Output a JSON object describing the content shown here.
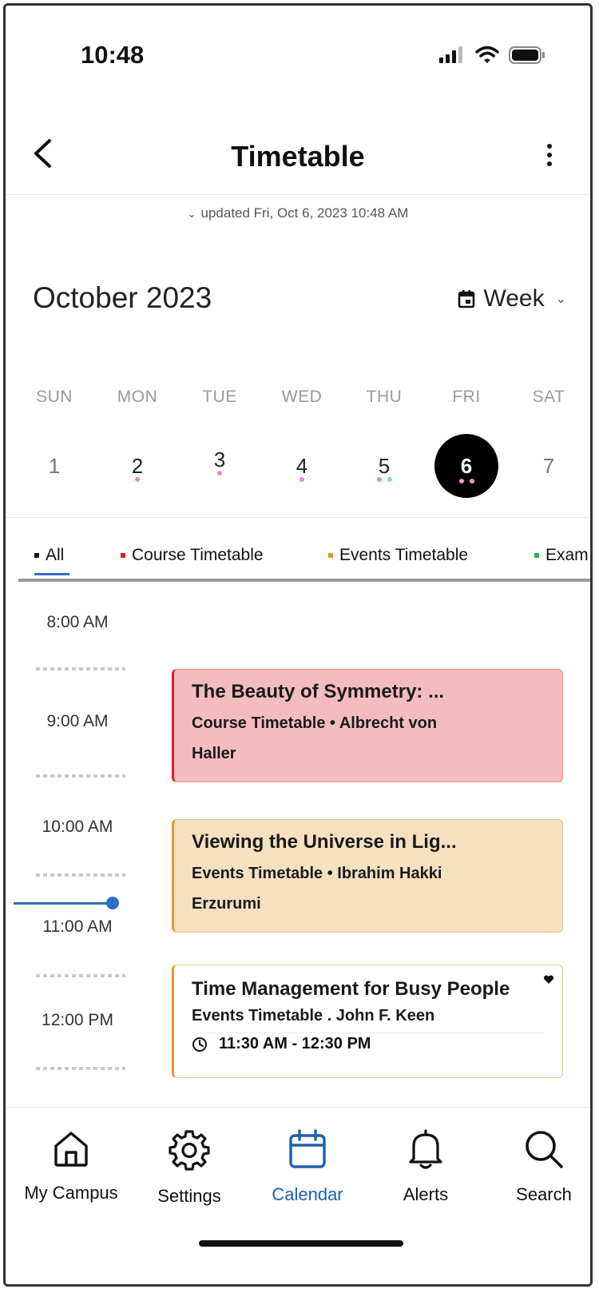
{
  "status_bar": {
    "time": "10:48"
  },
  "header": {
    "title": "Timetable",
    "updated": "updated Fri, Oct 6, 2023 10:48 AM"
  },
  "calendar": {
    "month": "October 2023",
    "view": "Week",
    "days": [
      {
        "name": "SUN",
        "num": "1"
      },
      {
        "name": "MON",
        "num": "2"
      },
      {
        "name": "TUE",
        "num": "3"
      },
      {
        "name": "WED",
        "num": "4"
      },
      {
        "name": "THU",
        "num": "5"
      },
      {
        "name": "FRI",
        "num": "6"
      },
      {
        "name": "SAT",
        "num": "7"
      }
    ],
    "selected_day": "6"
  },
  "tabs": [
    {
      "label": "All",
      "color": "#111111"
    },
    {
      "label": "Course Timetable",
      "color": "#d8202e"
    },
    {
      "label": "Events Timetable",
      "color": "#e8962d"
    },
    {
      "label": "Exam",
      "color": "#1fb25a"
    }
  ],
  "timeline": {
    "hours": [
      "8:00 AM",
      "9:00 AM",
      "10:00 AM",
      "11:00 AM",
      "12:00 PM"
    ]
  },
  "events": [
    {
      "title": "The Beauty of Symmetry: ...",
      "line1": "Course Timetable • Albrecht von",
      "line2": "Haller"
    },
    {
      "title": "Viewing the Universe in Lig...",
      "line1": "Events Timetable • Ibrahim Hakki",
      "line2": "Erzurumi"
    },
    {
      "title": "Time Management for Busy People",
      "line1": "Events Timetable . John F. Keen",
      "time": "11:30 AM - 12:30 PM"
    }
  ],
  "nav": [
    {
      "label": "My Campus",
      "icon": "home-icon"
    },
    {
      "label": "Settings",
      "icon": "gear-icon"
    },
    {
      "label": "Calendar",
      "icon": "calendar-icon"
    },
    {
      "label": "Alerts",
      "icon": "bell-icon"
    },
    {
      "label": "Search",
      "icon": "search-icon"
    }
  ],
  "colors": {
    "accent": "#1f5fae",
    "course": "#d8202e",
    "events": "#e8962d",
    "exam": "#1fb25a"
  }
}
